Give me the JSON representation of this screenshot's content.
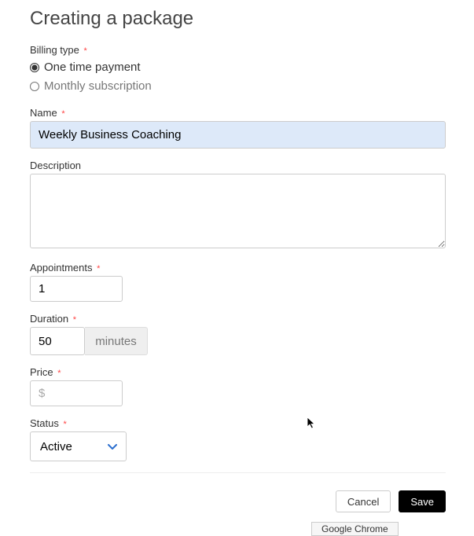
{
  "heading": "Creating a package",
  "billing_type": {
    "label": "Billing type",
    "one_time": "One time payment",
    "monthly": "Monthly subscription",
    "selected": "one_time"
  },
  "name": {
    "label": "Name",
    "value": "Weekly Business Coaching"
  },
  "description": {
    "label": "Description",
    "value": ""
  },
  "appointments": {
    "label": "Appointments",
    "value": "1"
  },
  "duration": {
    "label": "Duration",
    "value": "50",
    "unit": "minutes"
  },
  "price": {
    "label": "Price",
    "placeholder": "$",
    "value": ""
  },
  "status": {
    "label": "Status",
    "value": "Active"
  },
  "buttons": {
    "cancel": "Cancel",
    "save": "Save"
  },
  "tooltip": "Google Chrome",
  "asterisk": "*"
}
